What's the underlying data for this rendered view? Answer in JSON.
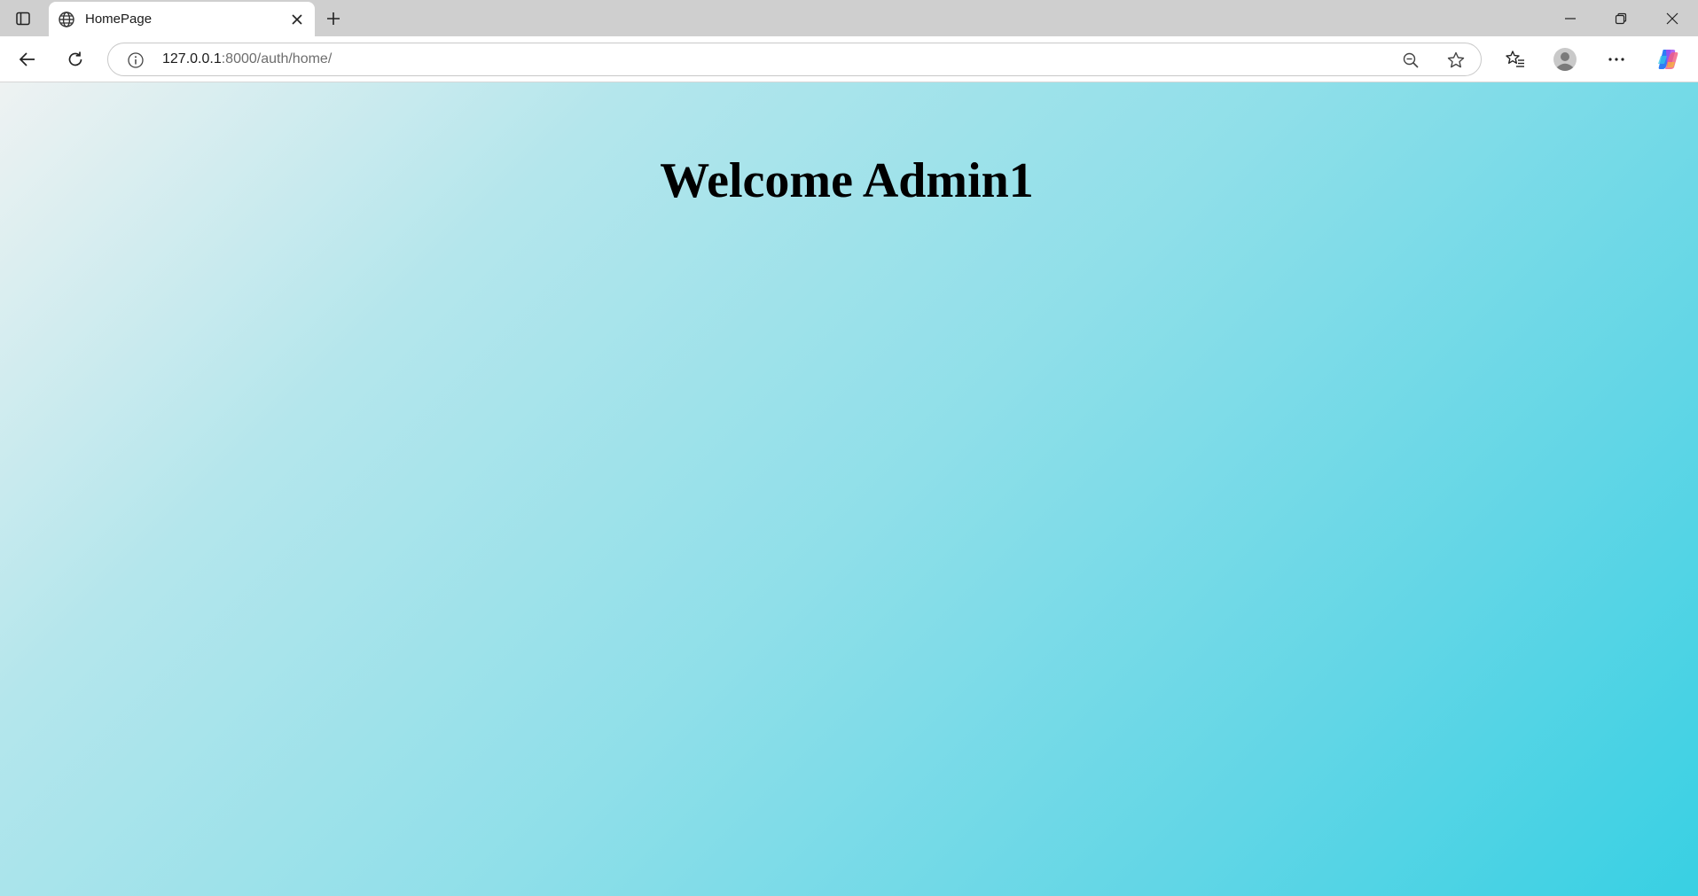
{
  "browser": {
    "tab": {
      "title": "HomePage",
      "favicon": "globe-icon"
    },
    "address": {
      "host": "127.0.0.1",
      "path": ":8000/auth/home/"
    },
    "icons": {
      "tab_actions": "tab-actions-icon",
      "close_tab": "close-icon",
      "new_tab": "plus-icon",
      "minimize": "minimize-icon",
      "restore": "restore-icon",
      "close_window": "close-icon",
      "back": "back-arrow-icon",
      "reload": "reload-icon",
      "site_info": "info-icon",
      "zoom": "zoom-out-icon",
      "favorite": "star-icon",
      "favorites": "favorites-icon",
      "profile": "profile-icon",
      "more": "more-icon",
      "copilot": "copilot-icon"
    }
  },
  "page": {
    "heading": "Welcome Admin1"
  },
  "colors": {
    "gradient_start": "#eef2f2",
    "gradient_end": "#38d0e3",
    "tabstrip_bg": "#cfcfcf"
  }
}
